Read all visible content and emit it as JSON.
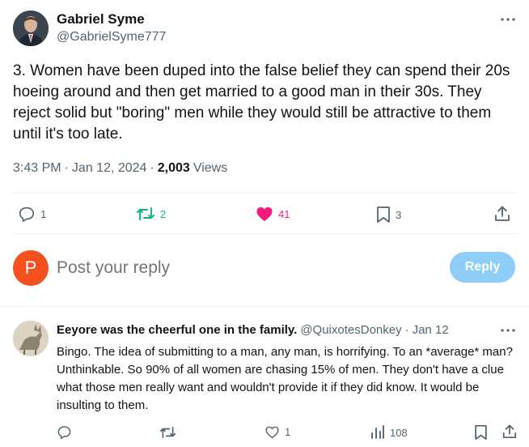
{
  "tweet": {
    "author_name": "Gabriel Syme",
    "author_handle": "@GabrielSyme777",
    "text": "3. Women have been duped into the false belief they can spend their 20s hoeing around and then get married to a good man in their 30s. They reject solid but \"boring\" men while they would still be attractive to them until it's too late.",
    "time": "3:43 PM",
    "date": "Jan 12, 2024",
    "separator": "·",
    "views_count": "2,003",
    "views_label": "Views",
    "replies": "1",
    "reposts": "2",
    "likes": "41",
    "bookmarks": "3"
  },
  "reply_box": {
    "avatar_letter": "P",
    "placeholder": "Post your reply",
    "button_label": "Reply"
  },
  "comment": {
    "author_name": "Eeyore was the cheerful one in the family.",
    "author_handle": "@QuixotesDonkey",
    "separator": "·",
    "date": "Jan 12",
    "text": "Bingo. The idea of submitting to a man, any man, is horrifying. To an *average* man? Unthinkable. So 90% of all women are chasing 15% of men. They don't have a clue what those men really want and wouldn't provide it if they did know. It would be insulting to them.",
    "replies": "",
    "reposts": "",
    "likes": "1",
    "views": "108"
  },
  "colors": {
    "repost_active": "#00ba7c",
    "like_active": "#f91880",
    "icon_gray": "#536471",
    "reply_avatar_bg": "#f4511e",
    "reply_button_bg": "#8ecdf7"
  }
}
